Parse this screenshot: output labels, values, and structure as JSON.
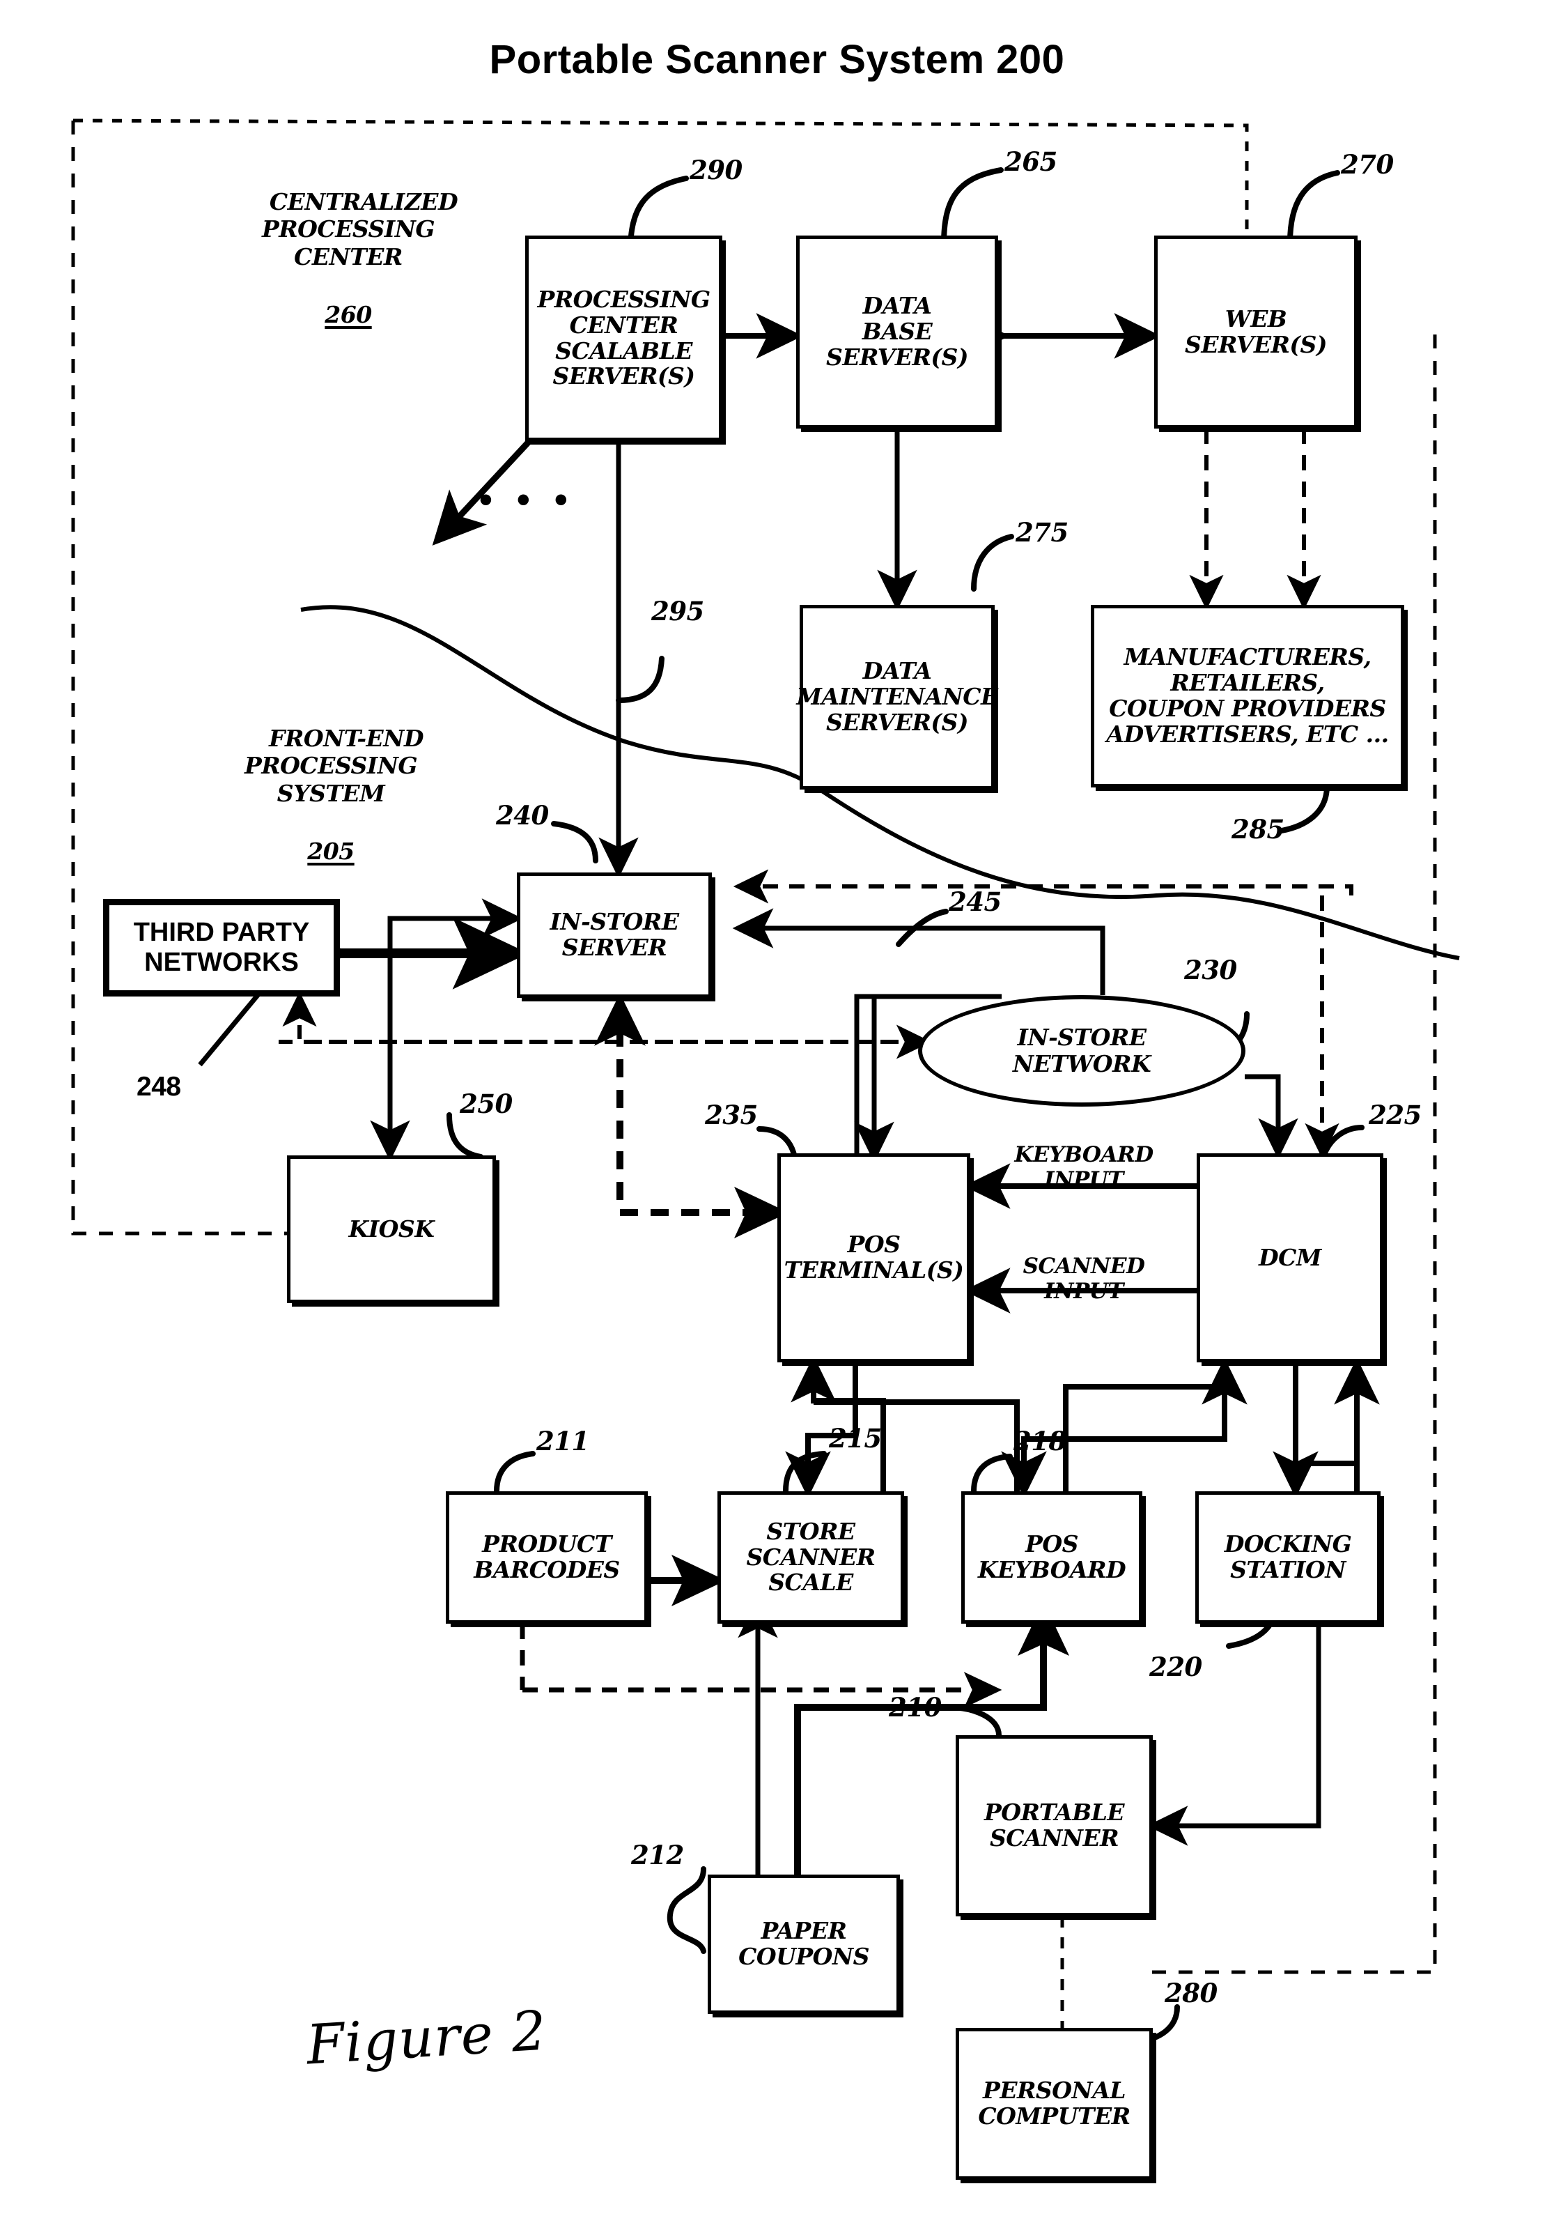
{
  "figure": {
    "title": "Portable Scanner System 200",
    "caption": "Figure 2"
  },
  "regions": [
    {
      "name": "centralized-processing-center",
      "label": "CENTRALIZED\nPROCESSING\nCENTER",
      "ref": "260"
    },
    {
      "name": "front-end-processing-system",
      "label": "FRONT-END\nPROCESSING\nSYSTEM",
      "ref": "205"
    }
  ],
  "nodes": {
    "processing_center_server": {
      "label": "PROCESSING\nCENTER\nSCALABLE\nSERVER(S)",
      "ref": "290"
    },
    "database_server": {
      "label": "DATA\nBASE\nSERVER(S)",
      "ref": "265"
    },
    "web_server": {
      "label": "WEB\nSERVER(S)",
      "ref": "270"
    },
    "data_maintenance_server": {
      "label": "DATA\nMAINTENANCE\nSERVER(S)",
      "ref": "275"
    },
    "manufacturers": {
      "label": "MANUFACTURERS,\nRETAILERS,\nCOUPON PROVIDERS\nADVERTISERS, ETC ...",
      "ref": "285"
    },
    "in_store_server": {
      "label": "IN-STORE\nSERVER",
      "ref": "240"
    },
    "third_party_networks": {
      "label": "THIRD PARTY\nNETWORKS",
      "ref": "248"
    },
    "kiosk": {
      "label": "KIOSK",
      "ref": "250"
    },
    "in_store_network": {
      "label": "IN-STORE\nNETWORK",
      "ref": "230"
    },
    "pos_terminal": {
      "label": "POS\nTERMINAL(S)",
      "ref": "235"
    },
    "dcm": {
      "label": "DCM",
      "ref": "225"
    },
    "product_barcodes": {
      "label": "PRODUCT\nBARCODES",
      "ref": "211"
    },
    "store_scanner_scale": {
      "label": "STORE\nSCANNER\nSCALE",
      "ref": "215"
    },
    "pos_keyboard": {
      "label": "POS\nKEYBOARD",
      "ref": "218"
    },
    "docking_station": {
      "label": "DOCKING\nSTATION",
      "ref": "220"
    },
    "paper_coupons": {
      "label": "PAPER\nCOUPONS",
      "ref": "212"
    },
    "portable_scanner": {
      "label": "PORTABLE\nSCANNER",
      "ref": "210"
    },
    "personal_computer": {
      "label": "PERSONAL\nCOMPUTER",
      "ref": "280"
    }
  },
  "connection_labels": {
    "keyboard_input": "KEYBOARD\nINPUT",
    "scanned_input": "SCANNED\nINPUT",
    "link_295": "295",
    "link_245": "245"
  },
  "ellipsis": "• • •"
}
